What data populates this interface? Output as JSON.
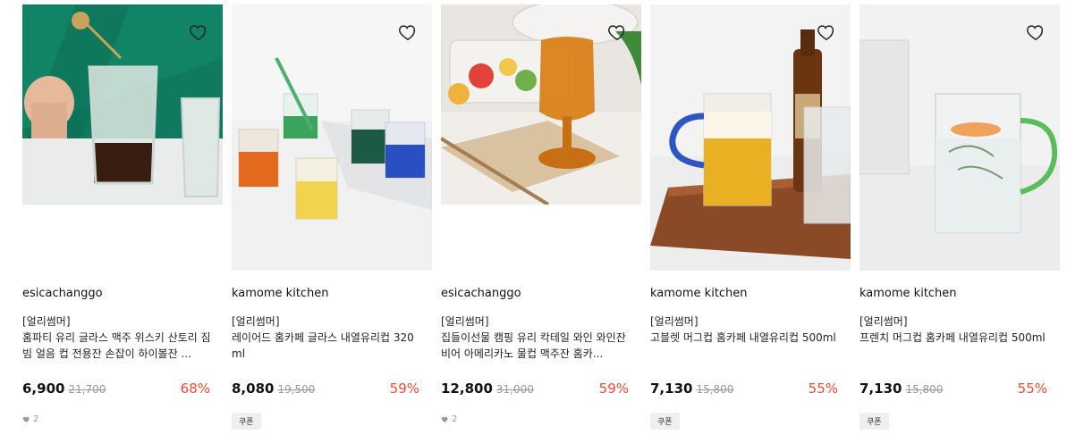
{
  "products": [
    {
      "brand": "esicachanggo",
      "tag": "[얼리썸머]",
      "title": "홈파티 유리 글라스 맥주 위스키 산토리 짐빔 얼음 컵 전용잔 손잡이 하이볼잔 ...",
      "price": "6,900",
      "original_price": "21,700",
      "discount": "68%",
      "likes": "2",
      "coupon": ""
    },
    {
      "brand": "kamome kitchen",
      "tag": "[얼리썸머]",
      "title": "레이어드 홈카페 글라스 내열유리컵 320ml",
      "price": "8,080",
      "original_price": "19,500",
      "discount": "59%",
      "likes": "",
      "coupon": "쿠폰"
    },
    {
      "brand": "esicachanggo",
      "tag": "[얼리썸머]",
      "title": "집들이선물 캠핑 유리 칵테일 와인 와인잔 비어 아메리카노 물컵 맥주잔 홈카...",
      "price": "12,800",
      "original_price": "31,000",
      "discount": "59%",
      "likes": "2",
      "coupon": ""
    },
    {
      "brand": "kamome kitchen",
      "tag": "[얼리썸머]",
      "title": "고블렛 머그컵 홈카페 내열유리컵 500ml",
      "price": "7,130",
      "original_price": "15,800",
      "discount": "55%",
      "likes": "",
      "coupon": "쿠폰"
    },
    {
      "brand": "kamome kitchen",
      "tag": "[얼리썸머]",
      "title": "프렌치 머그컵 홈카페 내열유리컵 500ml",
      "price": "7,130",
      "original_price": "15,800",
      "discount": "55%",
      "likes": "",
      "coupon": "쿠폰"
    }
  ],
  "colors": {
    "discount": "#ee4a36",
    "muted": "#999999",
    "coupon_bg": "#efefef"
  }
}
